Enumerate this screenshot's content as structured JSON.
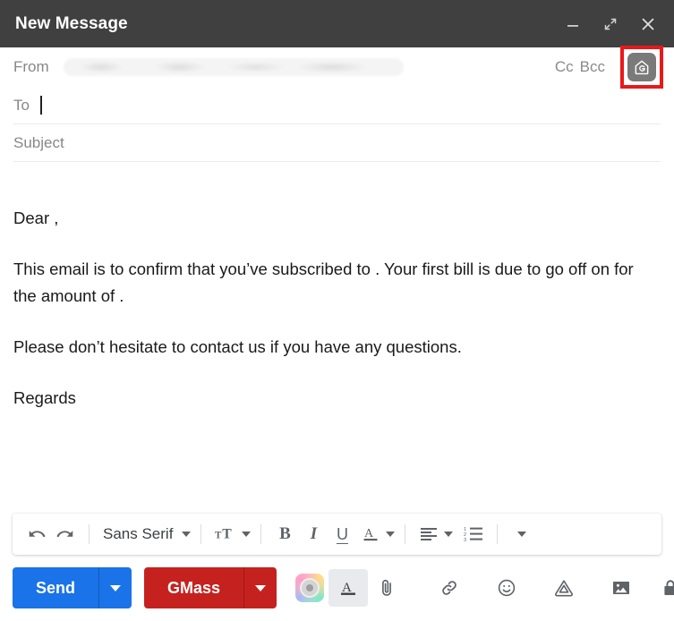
{
  "window": {
    "title": "New Message",
    "controls": [
      {
        "name": "minimize",
        "label": "Minimize"
      },
      {
        "name": "maximize",
        "label": "Full screen"
      },
      {
        "name": "close",
        "label": "Close"
      }
    ]
  },
  "fields": {
    "from_label": "From",
    "from_value": "",
    "from_redacted": true,
    "cc_label": "Cc",
    "bcc_label": "Bcc",
    "to_label": "To",
    "to_value": "",
    "subject_label": "Subject",
    "subject_value": ""
  },
  "gmass_button": {
    "name": "gmass-settings-icon",
    "highlighted": true,
    "highlight_color": "#e8191a",
    "background_color": "#7a7a7a"
  },
  "body": {
    "paragraphs": [
      "Dear ,",
      "This email is to confirm that you’ve subscribed to . Your first bill is due to go off on  for the amount of .",
      "Please don’t hesitate to contact us if you have any questions.",
      "Regards"
    ]
  },
  "format_toolbar": {
    "undo": "Undo",
    "redo": "Redo",
    "font_family": "Sans Serif",
    "font_size": "Size",
    "bold": "B",
    "italic": "I",
    "underline": "U",
    "text_color": "A",
    "align": "Align",
    "numbered_list": "Numbered list",
    "more_options": "More formatting options"
  },
  "action_bar": {
    "send_label": "Send",
    "send_color": "#1a73e8",
    "gmass_label": "GMass",
    "gmass_color": "#c5221f",
    "icons": [
      {
        "name": "gmass-color-icon",
        "label": "GMass"
      },
      {
        "name": "formatting-options-icon",
        "label": "Formatting options",
        "active": true
      },
      {
        "name": "attach-file-icon",
        "label": "Attach files"
      },
      {
        "name": "insert-link-icon",
        "label": "Insert link"
      },
      {
        "name": "insert-emoji-icon",
        "label": "Insert emoji"
      },
      {
        "name": "google-drive-icon",
        "label": "Insert files using Drive"
      },
      {
        "name": "insert-photo-icon",
        "label": "Insert photo"
      },
      {
        "name": "confidential-mode-icon",
        "label": "Toggle confidential mode"
      }
    ]
  }
}
